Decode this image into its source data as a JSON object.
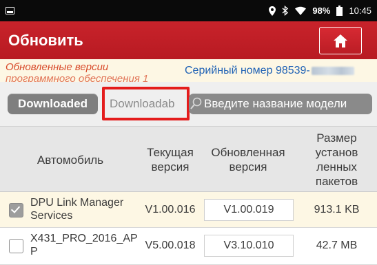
{
  "status_bar": {
    "battery_percent": "98%",
    "time": "10:45"
  },
  "header": {
    "title": "Обновить",
    "home_icon": "home-icon"
  },
  "info": {
    "updated_versions_line1": "Обновленные версии",
    "updated_versions_line2": "программного обеспечения 1",
    "serial_label": "Серийный номер",
    "serial_visible": "98539-"
  },
  "toolbar": {
    "downloaded_label": "Downloaded",
    "downloadable_label": "Downloadab",
    "search_placeholder": "Введите название модели"
  },
  "table": {
    "headers": {
      "car": "Автомобиль",
      "current_version": "Текущая версия",
      "updated_version": "Обновленная версия",
      "size": "Размер установ ленных пакетов"
    },
    "rows": [
      {
        "name": "DPU Link Manager Services",
        "current": "V1.00.016",
        "updated": "V1.00.019",
        "size": "913.1 KB",
        "checked": true
      },
      {
        "name": "X431_PRO_2016_APP",
        "current": "V5.00.018",
        "updated": "V3.10.010",
        "size": "42.7 MB",
        "checked": false
      }
    ]
  },
  "colors": {
    "title_bar": "#c01f27",
    "highlight": "#e41c1c",
    "serial_text": "#1f62b5",
    "info_text": "#d84a2a"
  }
}
